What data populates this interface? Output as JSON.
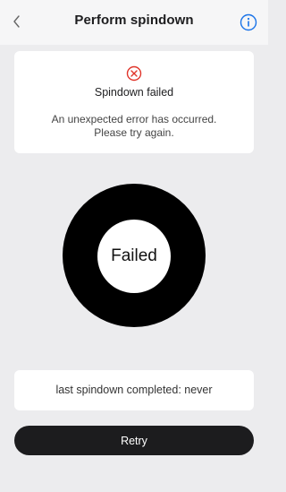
{
  "header": {
    "title": "Perform spindown",
    "back_icon": "chevron-left-icon",
    "info_icon": "info-icon"
  },
  "error": {
    "icon": "error-circle-x-icon",
    "title": "Spindown failed",
    "message_line1": "An unexpected error has occurred.",
    "message_line2": "Please try again."
  },
  "gauge": {
    "status": "Failed"
  },
  "status": {
    "last_spindown": "last spindown completed: never"
  },
  "actions": {
    "retry_label": "Retry"
  },
  "colors": {
    "accent": "#1a73e8",
    "error": "#e0342a",
    "button": "#1c1c1e",
    "background": "#ececee"
  }
}
